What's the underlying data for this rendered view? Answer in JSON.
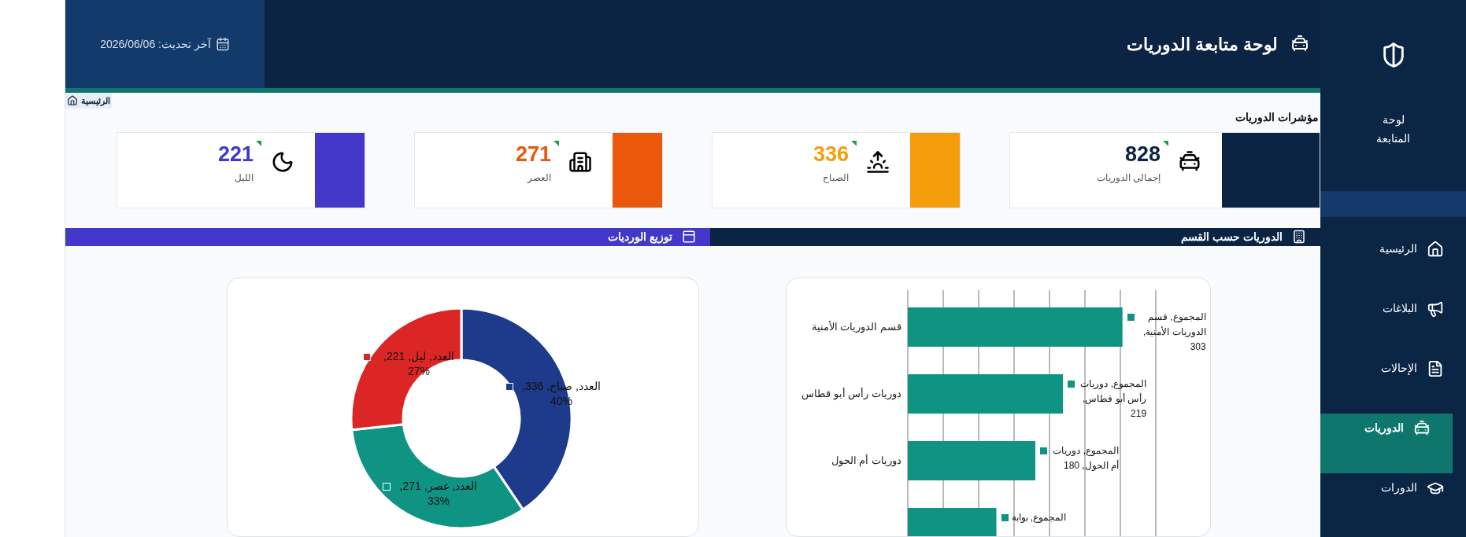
{
  "sidebar": {
    "brand_label": "لوحة المتابعة",
    "items": [
      {
        "label": "الرئيسية",
        "selected": false
      },
      {
        "label": "البلاغات",
        "selected": false
      },
      {
        "label": "الإحالات",
        "selected": false
      },
      {
        "label": "الدوريات",
        "selected": true
      },
      {
        "label": "الدورات",
        "selected": false
      }
    ]
  },
  "header": {
    "title": "لوحة متابعة الدوريات",
    "last_update": "آخر تحديث: 2026/06/06"
  },
  "breadcrumb": "الرئيسية",
  "indicators": {
    "title": "مؤشرات الدوريات",
    "cards": [
      {
        "value": "828",
        "label": "إجمالي الدوريات",
        "color": "#0c2444"
      },
      {
        "value": "336",
        "label": "الصباح",
        "color": "#f59e0b"
      },
      {
        "value": "271",
        "label": "العصر",
        "color": "#ea580c"
      },
      {
        "value": "221",
        "label": "الليل",
        "color": "#4338ca"
      }
    ]
  },
  "sections": [
    {
      "title": "الدوريات حسب القسم",
      "chart_data": {
        "type": "bar",
        "orientation": "horizontal",
        "categories": [
          "قسم الدوريات الأمنية",
          "دوريات رأس أبو قطاس",
          "دوريات أم الحول",
          null
        ],
        "values": [
          303,
          219,
          180,
          125
        ],
        "color": "#0f9484",
        "data_labels": true,
        "value_labels": [
          "المجموع, قسم الدوريات الأمنية, 303",
          "المجموع, دوريات رأس أبو قطاس, 219",
          "المجموع, دوريات أم الحول, 180",
          "المجموع, بوابة"
        ]
      }
    },
    {
      "title": "توزيع الورديات",
      "chart_data": {
        "type": "donut",
        "values": [
          336,
          271,
          221
        ],
        "colors": [
          "#1e3a8a",
          "#0f9484",
          "#dc2626"
        ],
        "value_labels": [
          "العدد, صباح, 336, %40",
          "العدد, عصر, 271, %33",
          "العدد, ليل, 221, %27"
        ]
      }
    }
  ]
}
